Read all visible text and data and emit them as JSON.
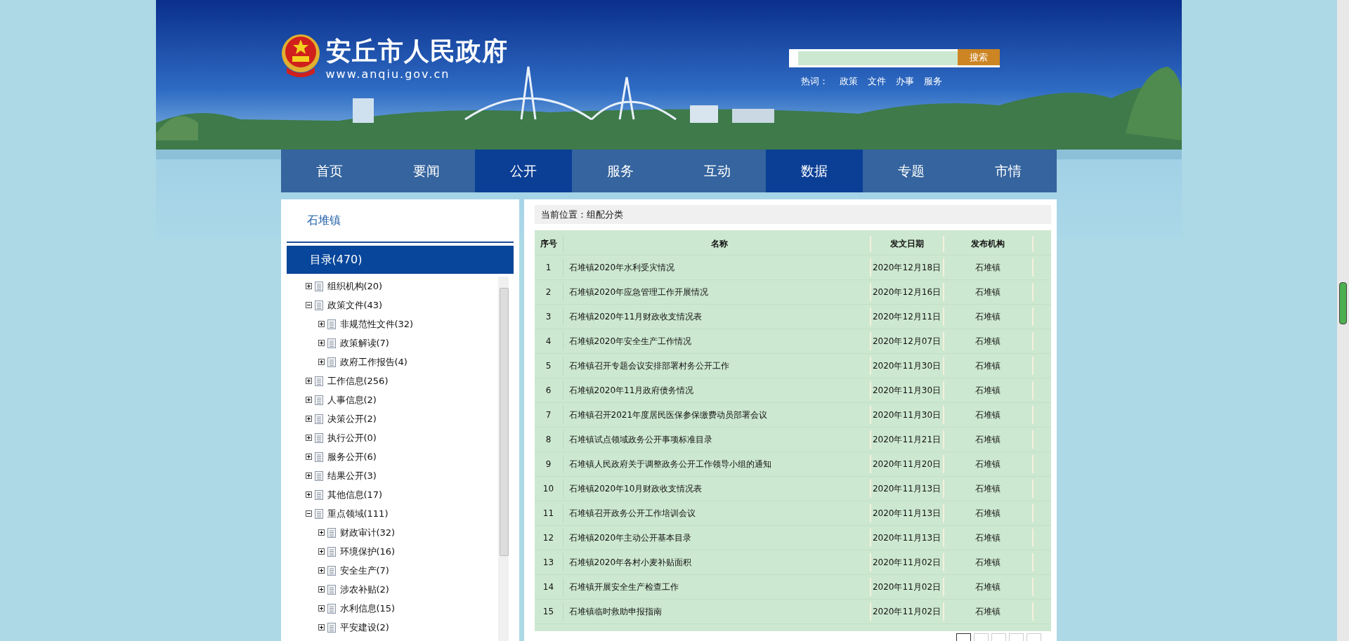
{
  "header": {
    "site_title": "安丘市人民政府",
    "site_url": "www.anqiu.gov.cn",
    "search": {
      "button": "搜索"
    },
    "hot_words_label": "热词：",
    "hot_words": [
      "政策",
      "文件",
      "办事",
      "服务"
    ]
  },
  "nav": [
    {
      "label": "首页",
      "selected": false
    },
    {
      "label": "要闻",
      "selected": false
    },
    {
      "label": "公开",
      "selected": true
    },
    {
      "label": "服务",
      "selected": false
    },
    {
      "label": "互动",
      "selected": false
    },
    {
      "label": "数据",
      "selected": true
    },
    {
      "label": "专题",
      "selected": false
    },
    {
      "label": "市情",
      "selected": false
    }
  ],
  "sidebar": {
    "title": "石堆镇",
    "catalog": "目录(470)",
    "tree": [
      {
        "label": "组织机构(20)",
        "expanded": false
      },
      {
        "label": "政策文件(43)",
        "expanded": true,
        "children": [
          {
            "label": "非规范性文件(32)",
            "expanded": false
          },
          {
            "label": "政策解读(7)",
            "expanded": false
          },
          {
            "label": "政府工作报告(4)",
            "expanded": false
          }
        ]
      },
      {
        "label": "工作信息(256)",
        "expanded": false
      },
      {
        "label": "人事信息(2)",
        "expanded": false
      },
      {
        "label": "决策公开(2)",
        "expanded": false
      },
      {
        "label": "执行公开(0)",
        "expanded": false
      },
      {
        "label": "服务公开(6)",
        "expanded": false
      },
      {
        "label": "结果公开(3)",
        "expanded": false
      },
      {
        "label": "其他信息(17)",
        "expanded": false
      },
      {
        "label": "重点领域(111)",
        "expanded": true,
        "children": [
          {
            "label": "财政审计(32)",
            "expanded": false
          },
          {
            "label": "环境保护(16)",
            "expanded": false
          },
          {
            "label": "安全生产(7)",
            "expanded": false
          },
          {
            "label": "涉农补贴(2)",
            "expanded": false
          },
          {
            "label": "水利信息(15)",
            "expanded": false
          },
          {
            "label": "平安建设(2)",
            "expanded": false
          }
        ]
      }
    ]
  },
  "breadcrumb": "当前位置：组配分类",
  "table": {
    "columns": [
      "序号",
      "名称",
      "发文日期",
      "发布机构"
    ],
    "rows": [
      [
        "1",
        "石堆镇2020年水利受灾情况",
        "2020年12月18日",
        "石堆镇"
      ],
      [
        "2",
        "石堆镇2020年应急管理工作开展情况",
        "2020年12月16日",
        "石堆镇"
      ],
      [
        "3",
        "石堆镇2020年11月财政收支情况表",
        "2020年12月11日",
        "石堆镇"
      ],
      [
        "4",
        "石堆镇2020年安全生产工作情况",
        "2020年12月07日",
        "石堆镇"
      ],
      [
        "5",
        "石堆镇召开专题会议安排部署村务公开工作",
        "2020年11月30日",
        "石堆镇"
      ],
      [
        "6",
        "石堆镇2020年11月政府债务情况",
        "2020年11月30日",
        "石堆镇"
      ],
      [
        "7",
        "石堆镇召开2021年度居民医保参保缴费动员部署会议",
        "2020年11月30日",
        "石堆镇"
      ],
      [
        "8",
        "石堆镇试点领域政务公开事项标准目录",
        "2020年11月21日",
        "石堆镇"
      ],
      [
        "9",
        "石堆镇人民政府关于调整政务公开工作领导小组的通知",
        "2020年11月20日",
        "石堆镇"
      ],
      [
        "10",
        "石堆镇2020年10月财政收支情况表",
        "2020年11月13日",
        "石堆镇"
      ],
      [
        "11",
        "石堆镇召开政务公开工作培训会议",
        "2020年11月13日",
        "石堆镇"
      ],
      [
        "12",
        "石堆镇2020年主动公开基本目录",
        "2020年11月13日",
        "石堆镇"
      ],
      [
        "13",
        "石堆镇2020年各村小麦补贴面积",
        "2020年11月02日",
        "石堆镇"
      ],
      [
        "14",
        "石堆镇开展安全生产检查工作",
        "2020年11月02日",
        "石堆镇"
      ],
      [
        "15",
        "石堆镇临时救助申报指南",
        "2020年11月02日",
        "石堆镇"
      ]
    ]
  },
  "pager": [
    {
      "selected": true
    },
    {
      "selected": false
    },
    {
      "selected": false
    },
    {
      "selected": false
    },
    {
      "selected": false
    }
  ]
}
